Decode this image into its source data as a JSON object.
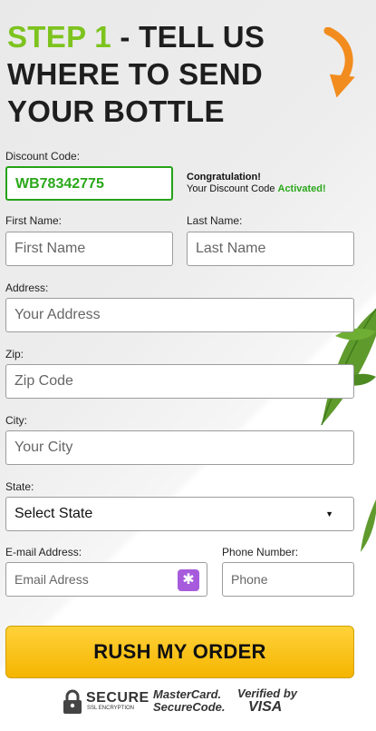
{
  "heading": {
    "step": "STEP 1",
    "rest": " - TELL US WHERE TO SEND YOUR BOTTLE"
  },
  "discount": {
    "label": "Discount Code:",
    "value": "WB78342775",
    "congrats_title": "Congratulation!",
    "congrats_text": "Your Discount Code ",
    "congrats_status": "Activated!"
  },
  "first_name": {
    "label": "First Name:",
    "placeholder": "First Name"
  },
  "last_name": {
    "label": "Last Name:",
    "placeholder": "Last Name"
  },
  "address": {
    "label": "Address:",
    "placeholder": "Your Address"
  },
  "zip": {
    "label": "Zip:",
    "placeholder": "Zip Code"
  },
  "city": {
    "label": "City:",
    "placeholder": "Your City"
  },
  "state": {
    "label": "State:",
    "selected": "Select State"
  },
  "email": {
    "label": "E-mail Address:",
    "placeholder": "Email Adress"
  },
  "phone": {
    "label": "Phone Number:",
    "placeholder": "Phone"
  },
  "submit": {
    "label": "RUSH MY ORDER"
  },
  "badges": {
    "secure_title": "SECURE",
    "secure_sub": "SSL ENCRYPTION",
    "mastercard_line1": "MasterCard.",
    "mastercard_line2": "SecureCode.",
    "visa_line1": "Verified by",
    "visa_line2": "VISA"
  },
  "colors": {
    "accent_green": "#7dc31e",
    "button_yellow": "#f9c515",
    "arrow_orange": "#f28c1e"
  },
  "icons": {
    "arrow": "curved-arrow-icon",
    "app": "extension-app-icon",
    "lock": "lock-icon",
    "caret": "caret-down-icon"
  }
}
